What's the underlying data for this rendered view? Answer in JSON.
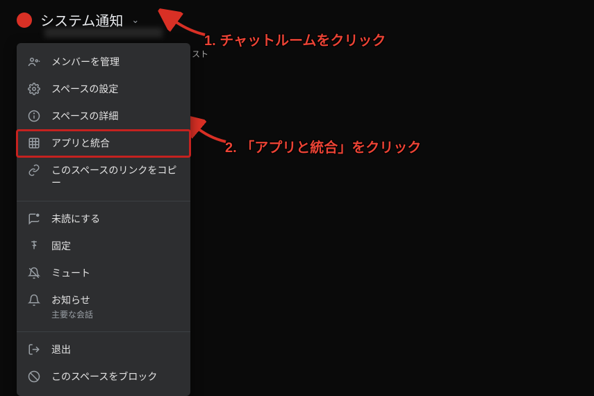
{
  "header": {
    "title": "システム通知"
  },
  "side_visible_text": "スト",
  "menu": {
    "items": [
      {
        "icon": "members-icon",
        "label": "メンバーを管理"
      },
      {
        "icon": "gear-icon",
        "label": "スペースの設定"
      },
      {
        "icon": "info-icon",
        "label": "スペースの詳細"
      },
      {
        "icon": "grid-icon",
        "label": "アプリと統合",
        "highlighted": true
      },
      {
        "icon": "link-icon",
        "label": "このスペースのリンクをコピー"
      }
    ],
    "items2": [
      {
        "icon": "unread-icon",
        "label": "未読にする"
      },
      {
        "icon": "pin-icon",
        "label": "固定"
      },
      {
        "icon": "mute-icon",
        "label": "ミュート"
      },
      {
        "icon": "bell-icon",
        "label": "お知らせ",
        "sublabel": "主要な会話"
      }
    ],
    "items3": [
      {
        "icon": "exit-icon",
        "label": "退出"
      },
      {
        "icon": "block-icon",
        "label": "このスペースをブロック"
      }
    ]
  },
  "annotations": {
    "step1": "1. チャットルームをクリック",
    "step2": "2. 「アプリと統合」をクリック"
  }
}
